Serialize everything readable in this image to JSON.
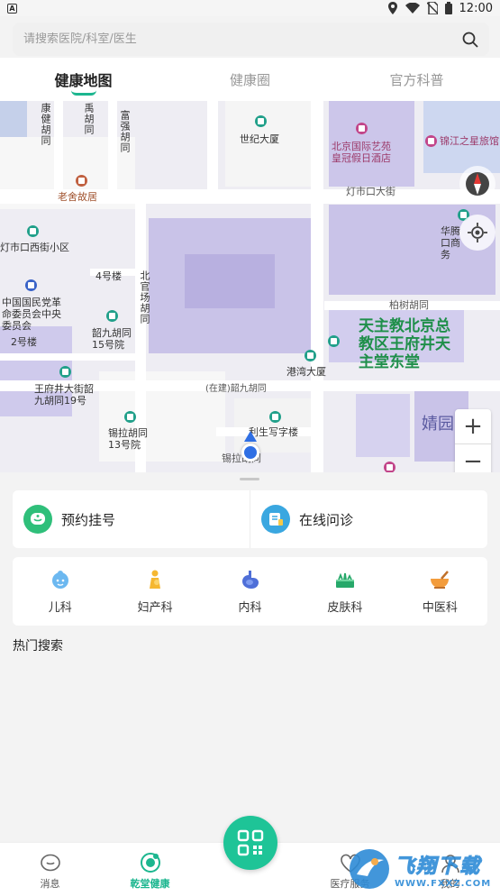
{
  "status_bar": {
    "time": "12:00"
  },
  "search": {
    "placeholder": "请搜索医院/科室/医生"
  },
  "tabs": [
    {
      "label": "健康地图"
    },
    {
      "label": "健康圈"
    },
    {
      "label": "官方科普"
    }
  ],
  "map": {
    "labels": {
      "kangjian": "康健胡同",
      "yu": "禹胡同",
      "fuqiang": "富强胡同",
      "century": "世纪大厦",
      "laoshe": "老舍故居",
      "beijing_hotel": "北京国际艺苑皇冠假日酒店",
      "jinjiang": "锦江之星旅馆",
      "dengshikou_street": "灯市口大街",
      "dengshikou_west": "灯市口西街小区",
      "huafu": "华腾口商务",
      "bldg4": "4号楼",
      "beiguanchang": "北官场胡同",
      "cpc": "中国国民党革命委员会中央委员会",
      "shao9": "韶九胡同15号院",
      "bldg2": "2号楼",
      "baishu": "柏树胡同",
      "church": "天主教北京总教区王府井天主堂东堂",
      "gangwan": "港湾大厦",
      "wangfujing": "王府井大街韶九胡同19号",
      "shao9_road": "(在建)韶九胡同",
      "xila13": "锡拉胡同13号院",
      "lisheng": "利生写字楼",
      "xila_road": "锡拉胡同",
      "jingyuan": "婧园",
      "zaijian": "(在建)"
    },
    "zoom_in": "+",
    "zoom_out": "−"
  },
  "quick_actions": [
    {
      "label": "预约挂号",
      "icon": "appointment-icon",
      "color": "#2fbf7a"
    },
    {
      "label": "在线问诊",
      "icon": "consultation-icon",
      "color": "#3aa7e0"
    }
  ],
  "departments": [
    {
      "label": "儿科",
      "icon": "pediatrics-icon"
    },
    {
      "label": "妇产科",
      "icon": "obstetrics-icon"
    },
    {
      "label": "内科",
      "icon": "internal-medicine-icon"
    },
    {
      "label": "皮肤科",
      "icon": "dermatology-icon"
    },
    {
      "label": "中医科",
      "icon": "tcm-icon"
    }
  ],
  "hot_search_title": "热门搜索",
  "bottom_nav": [
    {
      "label": "消息",
      "icon": "message-icon"
    },
    {
      "label": "乾堂健康",
      "icon": "qiantang-health-icon"
    },
    {
      "label": "",
      "icon": "scan-icon"
    },
    {
      "label": "医疗服务",
      "icon": "medical-service-icon"
    },
    {
      "label": "我的",
      "icon": "profile-icon"
    }
  ],
  "watermark": {
    "big": "飞翔下载",
    "small": "WWW.FXXZ.COM"
  },
  "colors": {
    "accent": "#1cb68f",
    "map_building": "#c9c3e8",
    "map_road": "#ffffff"
  }
}
